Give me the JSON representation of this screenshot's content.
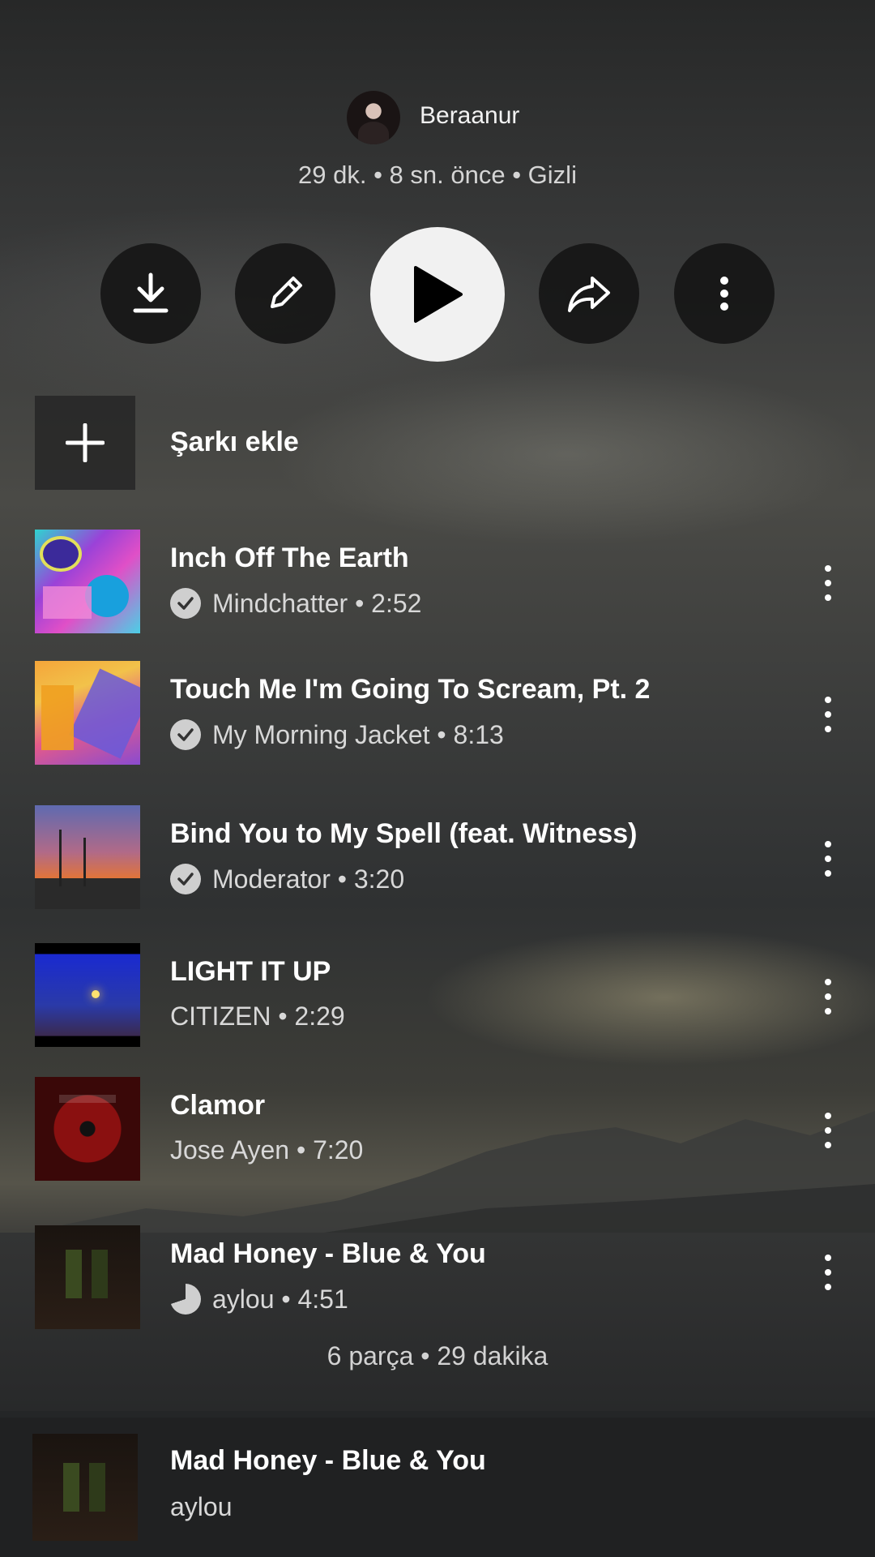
{
  "playlist": {
    "owner": "Beraanur",
    "meta": "29 dk. • 8 sn. önce • Gizli"
  },
  "actions": {
    "download_icon": "download-icon",
    "edit_icon": "pencil-icon",
    "play_icon": "play-icon",
    "share_icon": "share-icon",
    "more_icon": "more-vertical-icon"
  },
  "add_song": {
    "label": "Şarkı ekle"
  },
  "tracks": [
    {
      "title": "Inch Off The Earth",
      "subtitle": "Mindchatter • 2:52",
      "verified": true
    },
    {
      "title": "Touch Me I'm Going To Scream, Pt. 2",
      "subtitle": "My Morning Jacket • 8:13",
      "verified": true
    },
    {
      "title": "Bind You to My Spell (feat. Witness)",
      "subtitle": "Moderator • 3:20",
      "verified": true
    },
    {
      "title": "LIGHT IT UP",
      "subtitle": "CITIZEN • 2:29",
      "verified": false
    },
    {
      "title": "Clamor",
      "subtitle": "Jose Ayen • 7:20",
      "verified": false
    },
    {
      "title": "Mad Honey - Blue & You",
      "subtitle": "aylou • 4:51",
      "verified": true
    }
  ],
  "summary": "6 parça • 29 dakika",
  "now_playing": {
    "title": "Mad Honey - Blue & You",
    "artist": "aylou"
  },
  "colors": {
    "play_button": "#f1f1f1",
    "action_button": "#161616",
    "accent_text": "#ffffff"
  }
}
